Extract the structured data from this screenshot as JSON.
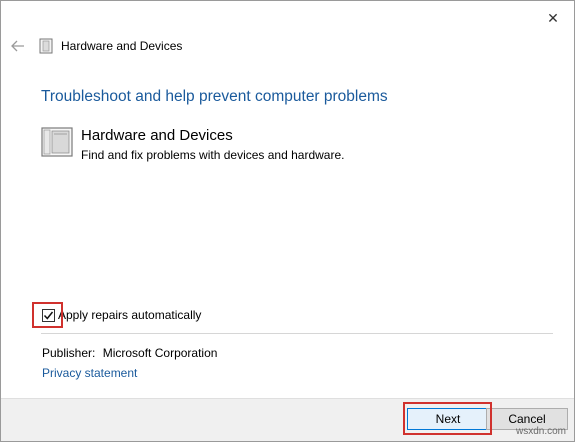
{
  "window": {
    "title": "Hardware and Devices",
    "close_symbol": "✕"
  },
  "content": {
    "heading": "Troubleshoot and help prevent computer problems",
    "item_title": "Hardware and Devices",
    "item_description": "Find and fix problems with devices and hardware.",
    "checkbox_label": "Apply repairs automatically",
    "checkbox_checked": true,
    "publisher_label": "Publisher:",
    "publisher_value": "Microsoft Corporation",
    "privacy_link": "Privacy statement"
  },
  "footer": {
    "next_label": "Next",
    "cancel_label": "Cancel"
  },
  "watermark": "wsxdn.com",
  "colors": {
    "link_blue": "#1a5a9c",
    "highlight_red": "#d0312d"
  },
  "icons": {
    "back": "back-arrow-icon",
    "close": "close-icon",
    "device": "hardware-device-icon"
  }
}
